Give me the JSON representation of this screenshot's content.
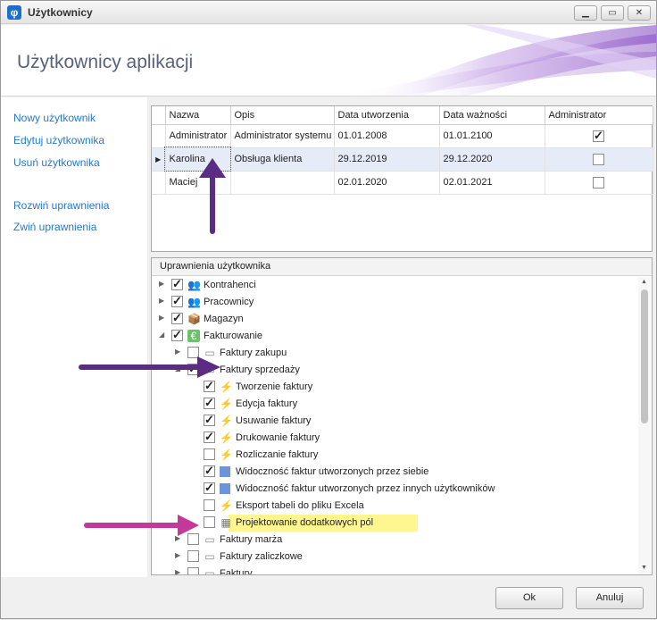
{
  "window": {
    "title": "Użytkownicy",
    "icon": "app-logo-icon"
  },
  "header": {
    "title": "Użytkownicy aplikacji"
  },
  "sidebar": {
    "items": [
      {
        "label": "Nowy użytkownik"
      },
      {
        "label": "Edytuj użytkownika"
      },
      {
        "label": "Usuń użytkownika"
      },
      {
        "label": "Rozwiń uprawnienia"
      },
      {
        "label": "Zwiń uprawnienia"
      }
    ]
  },
  "users_grid": {
    "columns": [
      "Nazwa",
      "Opis",
      "Data utworzenia",
      "Data ważności",
      "Administrator"
    ],
    "rows": [
      {
        "name": "Administrator",
        "description": "Administrator systemu",
        "created": "01.01.2008",
        "expires": "01.01.2100",
        "admin": true
      },
      {
        "name": "Karolina",
        "description": "Obsługa klienta",
        "created": "29.12.2019",
        "expires": "29.12.2020",
        "admin": false,
        "selected": true
      },
      {
        "name": "Maciej",
        "description": "",
        "created": "02.01.2020",
        "expires": "02.01.2021",
        "admin": false
      }
    ]
  },
  "permissions": {
    "header": "Uprawnienia użytkownika",
    "nodes": [
      {
        "label": "Kontrahenci",
        "checked": true,
        "expander": "right",
        "icon": "people-green-icon",
        "level": 0
      },
      {
        "label": "Pracownicy",
        "checked": true,
        "expander": "right",
        "icon": "people-orange-icon",
        "level": 0
      },
      {
        "label": "Magazyn",
        "checked": true,
        "expander": "right",
        "icon": "warehouse-icon",
        "level": 0
      },
      {
        "label": "Fakturowanie",
        "checked": true,
        "expander": "down",
        "icon": "euro-icon",
        "level": 0
      },
      {
        "label": "Faktury zakupu",
        "checked": false,
        "expander": "right",
        "icon": "folder-gray-icon",
        "level": 1
      },
      {
        "label": "Faktury sprzedaży",
        "checked": true,
        "expander": "down",
        "icon": "folder-gray-icon",
        "level": 1
      },
      {
        "label": "Tworzenie faktury",
        "checked": true,
        "icon": "lightning-icon",
        "level": 2
      },
      {
        "label": "Edycja faktury",
        "checked": true,
        "icon": "lightning-icon",
        "level": 2
      },
      {
        "label": "Usuwanie faktury",
        "checked": true,
        "icon": "lightning-icon",
        "level": 2
      },
      {
        "label": "Drukowanie faktury",
        "checked": true,
        "icon": "lightning-icon",
        "level": 2
      },
      {
        "label": "Rozliczanie faktury",
        "checked": false,
        "icon": "lightning-icon",
        "level": 2
      },
      {
        "label": "Widoczność faktur utworzonych przez siebie",
        "checked": true,
        "icon": "blue-square-icon",
        "level": 2
      },
      {
        "label": "Widoczność faktur utworzonych przez innych użytkowników",
        "checked": true,
        "icon": "blue-square-icon",
        "level": 2
      },
      {
        "label": "Eksport tabeli do pliku Excela",
        "checked": false,
        "icon": "lightning-icon",
        "level": 2
      },
      {
        "label": "Projektowanie dodatkowych pól",
        "checked": false,
        "icon": "grid-design-icon",
        "level": 2,
        "highlighted": true
      },
      {
        "label": "Faktury marża",
        "checked": false,
        "expander": "right",
        "icon": "folder-gray-icon",
        "level": 1
      },
      {
        "label": "Faktury zaliczkowe",
        "checked": false,
        "expander": "right",
        "icon": "folder-gray-icon",
        "level": 1
      },
      {
        "label": "Faktury ...",
        "checked": false,
        "expander": "right",
        "icon": "folder-gray-icon",
        "level": 1
      }
    ]
  },
  "footer": {
    "ok_label": "Ok",
    "cancel_label": "Anuluj"
  },
  "colors": {
    "link": "#1f7ad1",
    "highlight": "#fff68f",
    "arrow_purple": "#5b2c83",
    "arrow_magenta": "#c2399a",
    "header_title": "#59627c"
  }
}
